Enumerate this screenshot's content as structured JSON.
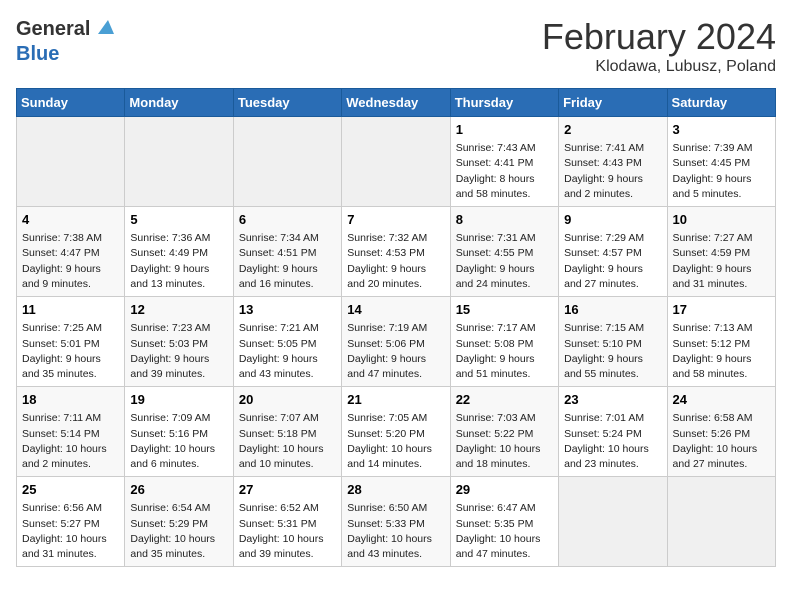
{
  "header": {
    "logo_general": "General",
    "logo_blue": "Blue",
    "title": "February 2024",
    "location": "Klodawa, Lubusz, Poland"
  },
  "days_of_week": [
    "Sunday",
    "Monday",
    "Tuesday",
    "Wednesday",
    "Thursday",
    "Friday",
    "Saturday"
  ],
  "weeks": [
    [
      {
        "day": "",
        "info": ""
      },
      {
        "day": "",
        "info": ""
      },
      {
        "day": "",
        "info": ""
      },
      {
        "day": "",
        "info": ""
      },
      {
        "day": "1",
        "info": "Sunrise: 7:43 AM\nSunset: 4:41 PM\nDaylight: 8 hours and 58 minutes."
      },
      {
        "day": "2",
        "info": "Sunrise: 7:41 AM\nSunset: 4:43 PM\nDaylight: 9 hours and 2 minutes."
      },
      {
        "day": "3",
        "info": "Sunrise: 7:39 AM\nSunset: 4:45 PM\nDaylight: 9 hours and 5 minutes."
      }
    ],
    [
      {
        "day": "4",
        "info": "Sunrise: 7:38 AM\nSunset: 4:47 PM\nDaylight: 9 hours and 9 minutes."
      },
      {
        "day": "5",
        "info": "Sunrise: 7:36 AM\nSunset: 4:49 PM\nDaylight: 9 hours and 13 minutes."
      },
      {
        "day": "6",
        "info": "Sunrise: 7:34 AM\nSunset: 4:51 PM\nDaylight: 9 hours and 16 minutes."
      },
      {
        "day": "7",
        "info": "Sunrise: 7:32 AM\nSunset: 4:53 PM\nDaylight: 9 hours and 20 minutes."
      },
      {
        "day": "8",
        "info": "Sunrise: 7:31 AM\nSunset: 4:55 PM\nDaylight: 9 hours and 24 minutes."
      },
      {
        "day": "9",
        "info": "Sunrise: 7:29 AM\nSunset: 4:57 PM\nDaylight: 9 hours and 27 minutes."
      },
      {
        "day": "10",
        "info": "Sunrise: 7:27 AM\nSunset: 4:59 PM\nDaylight: 9 hours and 31 minutes."
      }
    ],
    [
      {
        "day": "11",
        "info": "Sunrise: 7:25 AM\nSunset: 5:01 PM\nDaylight: 9 hours and 35 minutes."
      },
      {
        "day": "12",
        "info": "Sunrise: 7:23 AM\nSunset: 5:03 PM\nDaylight: 9 hours and 39 minutes."
      },
      {
        "day": "13",
        "info": "Sunrise: 7:21 AM\nSunset: 5:05 PM\nDaylight: 9 hours and 43 minutes."
      },
      {
        "day": "14",
        "info": "Sunrise: 7:19 AM\nSunset: 5:06 PM\nDaylight: 9 hours and 47 minutes."
      },
      {
        "day": "15",
        "info": "Sunrise: 7:17 AM\nSunset: 5:08 PM\nDaylight: 9 hours and 51 minutes."
      },
      {
        "day": "16",
        "info": "Sunrise: 7:15 AM\nSunset: 5:10 PM\nDaylight: 9 hours and 55 minutes."
      },
      {
        "day": "17",
        "info": "Sunrise: 7:13 AM\nSunset: 5:12 PM\nDaylight: 9 hours and 58 minutes."
      }
    ],
    [
      {
        "day": "18",
        "info": "Sunrise: 7:11 AM\nSunset: 5:14 PM\nDaylight: 10 hours and 2 minutes."
      },
      {
        "day": "19",
        "info": "Sunrise: 7:09 AM\nSunset: 5:16 PM\nDaylight: 10 hours and 6 minutes."
      },
      {
        "day": "20",
        "info": "Sunrise: 7:07 AM\nSunset: 5:18 PM\nDaylight: 10 hours and 10 minutes."
      },
      {
        "day": "21",
        "info": "Sunrise: 7:05 AM\nSunset: 5:20 PM\nDaylight: 10 hours and 14 minutes."
      },
      {
        "day": "22",
        "info": "Sunrise: 7:03 AM\nSunset: 5:22 PM\nDaylight: 10 hours and 18 minutes."
      },
      {
        "day": "23",
        "info": "Sunrise: 7:01 AM\nSunset: 5:24 PM\nDaylight: 10 hours and 23 minutes."
      },
      {
        "day": "24",
        "info": "Sunrise: 6:58 AM\nSunset: 5:26 PM\nDaylight: 10 hours and 27 minutes."
      }
    ],
    [
      {
        "day": "25",
        "info": "Sunrise: 6:56 AM\nSunset: 5:27 PM\nDaylight: 10 hours and 31 minutes."
      },
      {
        "day": "26",
        "info": "Sunrise: 6:54 AM\nSunset: 5:29 PM\nDaylight: 10 hours and 35 minutes."
      },
      {
        "day": "27",
        "info": "Sunrise: 6:52 AM\nSunset: 5:31 PM\nDaylight: 10 hours and 39 minutes."
      },
      {
        "day": "28",
        "info": "Sunrise: 6:50 AM\nSunset: 5:33 PM\nDaylight: 10 hours and 43 minutes."
      },
      {
        "day": "29",
        "info": "Sunrise: 6:47 AM\nSunset: 5:35 PM\nDaylight: 10 hours and 47 minutes."
      },
      {
        "day": "",
        "info": ""
      },
      {
        "day": "",
        "info": ""
      }
    ]
  ]
}
